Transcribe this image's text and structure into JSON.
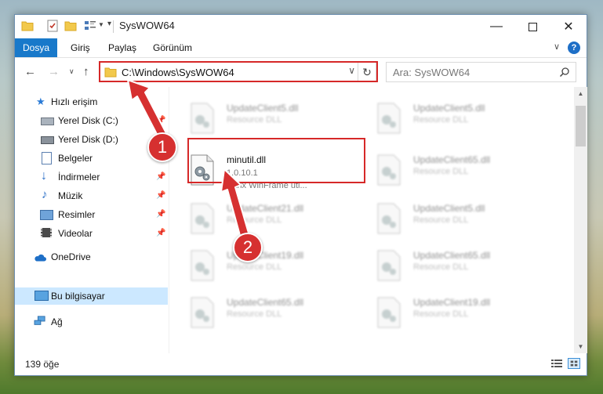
{
  "window": {
    "title": "SysWOW64"
  },
  "ribbon": {
    "tabs": [
      "Dosya",
      "Giriş",
      "Paylaş",
      "Görünüm"
    ],
    "active_tab": "Dosya",
    "help": "?"
  },
  "navbar": {
    "address": "C:\\Windows\\SysWOW64",
    "search_placeholder": "Ara: SysWOW64"
  },
  "sidebar": {
    "items": [
      {
        "label": "Hızlı erişim",
        "icon": "star-icon",
        "pinned": false
      },
      {
        "label": "Yerel Disk (C:)",
        "icon": "drive-icon",
        "pinned": true
      },
      {
        "label": "Yerel Disk (D:)",
        "icon": "drive-icon",
        "pinned": false
      },
      {
        "label": "Belgeler",
        "icon": "documents-icon",
        "pinned": true
      },
      {
        "label": "İndirmeler",
        "icon": "download-icon",
        "pinned": true
      },
      {
        "label": "Müzik",
        "icon": "music-icon",
        "pinned": true
      },
      {
        "label": "Resimler",
        "icon": "pictures-icon",
        "pinned": true
      },
      {
        "label": "Videolar",
        "icon": "videos-icon",
        "pinned": true
      },
      {
        "label": "OneDrive",
        "icon": "cloud-icon",
        "pinned": false
      },
      {
        "label": "Bu bilgisayar",
        "icon": "computer-icon",
        "pinned": false,
        "selected": true
      },
      {
        "label": "Ağ",
        "icon": "network-icon",
        "pinned": false
      }
    ]
  },
  "files": [
    {
      "name": "UpdateClient5.dll",
      "desc": "Resource DLL",
      "blurred": true
    },
    {
      "name": "UpdateClient5.dll",
      "desc": "Resource DLL",
      "blurred": true
    },
    {
      "name": "minutil.dll",
      "version": "1.0.10.1",
      "desc": "Citrix WinFrame uti...",
      "blurred": false
    },
    {
      "name": "UpdateClient65.dll",
      "desc": "Resource DLL",
      "blurred": true
    },
    {
      "name": "UpdateClient21.dll",
      "desc": "Resource DLL",
      "blurred": true
    },
    {
      "name": "UpdateClient5.dll",
      "desc": "Resource DLL",
      "blurred": true
    },
    {
      "name": "UpdateClient19.dll",
      "desc": "Resource DLL",
      "blurred": true
    },
    {
      "name": "UpdateClient65.dll",
      "desc": "Resource DLL",
      "blurred": true
    },
    {
      "name": "UpdateClient65.dll",
      "desc": "Resource DLL",
      "blurred": true
    },
    {
      "name": "UpdateClient19.dll",
      "desc": "Resource DLL",
      "blurred": true
    }
  ],
  "status": {
    "item_count": "139 öğe"
  },
  "callouts": [
    "1",
    "2"
  ],
  "colors": {
    "accent": "#1979ca",
    "highlight": "#d62828",
    "selection": "#cce8ff"
  }
}
